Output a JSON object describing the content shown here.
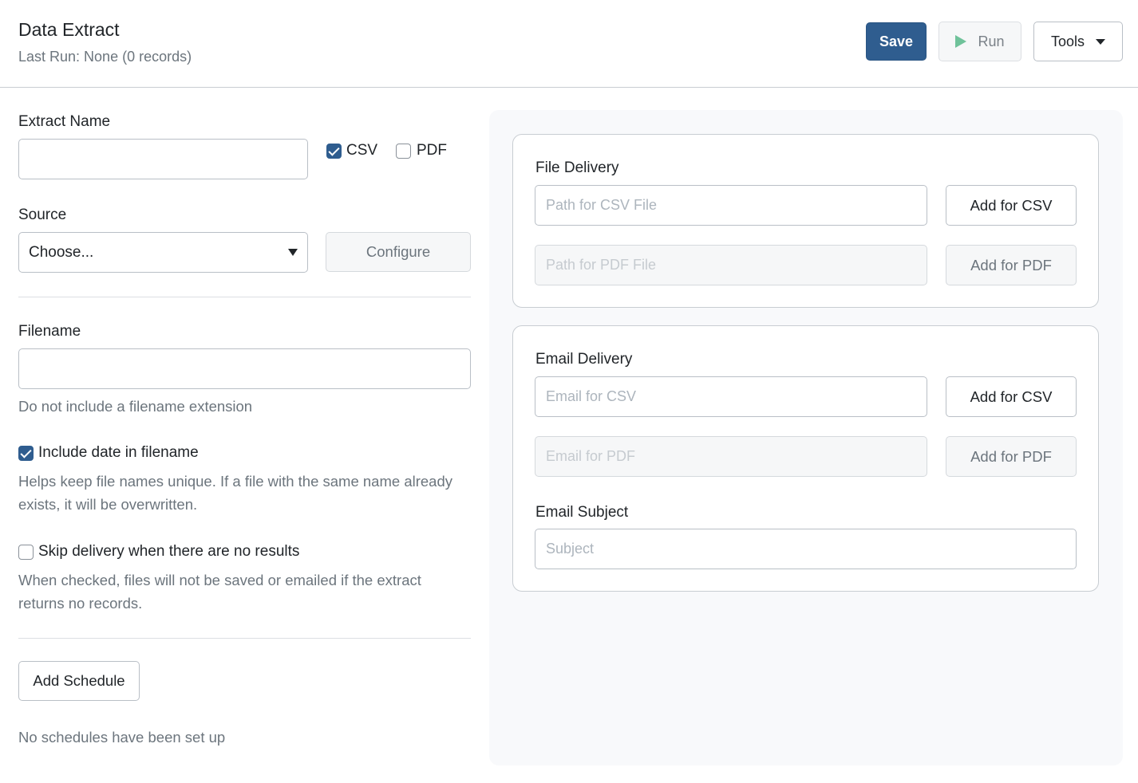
{
  "header": {
    "title": "Data Extract",
    "subtitle": "Last Run: None (0 records)",
    "save_label": "Save",
    "run_label": "Run",
    "tools_label": "Tools"
  },
  "left": {
    "extract_name_label": "Extract Name",
    "extract_name_value": "",
    "csv_label": "CSV",
    "csv_checked": true,
    "pdf_label": "PDF",
    "pdf_checked": false,
    "source_label": "Source",
    "source_selected": "Choose...",
    "configure_label": "Configure",
    "filename_label": "Filename",
    "filename_value": "",
    "filename_help": "Do not include a filename extension",
    "include_date_label": "Include date in filename",
    "include_date_checked": true,
    "include_date_help": "Helps keep file names unique. If a file with the same name already exists, it will be overwritten.",
    "skip_delivery_label": "Skip delivery when there are no results",
    "skip_delivery_checked": false,
    "skip_delivery_help": "When checked, files will not be saved or emailed if the extract returns no records.",
    "add_schedule_label": "Add Schedule",
    "no_schedules_text": "No schedules have been set up"
  },
  "file_delivery": {
    "title": "File Delivery",
    "csv_path_placeholder": "Path for CSV File",
    "pdf_path_placeholder": "Path for PDF File",
    "add_csv_label": "Add for CSV",
    "add_pdf_label": "Add for PDF"
  },
  "email_delivery": {
    "title": "Email Delivery",
    "csv_email_placeholder": "Email for CSV",
    "pdf_email_placeholder": "Email for PDF",
    "add_csv_label": "Add for CSV",
    "add_pdf_label": "Add for PDF",
    "subject_label": "Email Subject",
    "subject_placeholder": "Subject"
  },
  "colors": {
    "primary": "#2f5d8f",
    "run_icon": "#6fc29a",
    "muted_text": "#6c757d",
    "panel_bg": "#f8f9fb"
  }
}
